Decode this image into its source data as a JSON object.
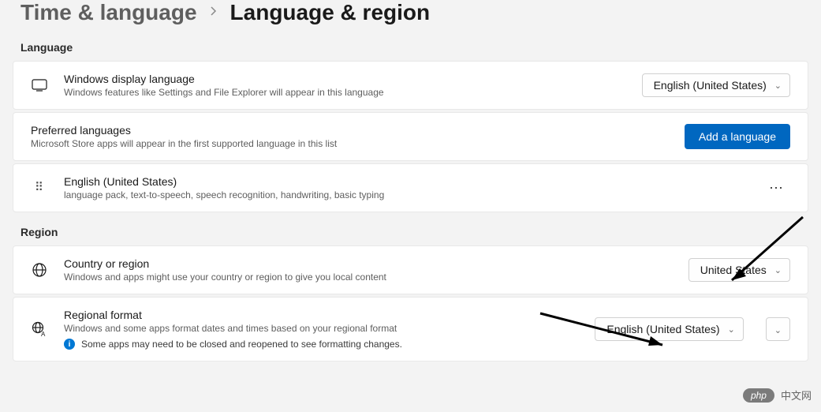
{
  "breadcrumb": {
    "parent": "Time & language",
    "current": "Language & region"
  },
  "sections": {
    "language": {
      "title": "Language"
    },
    "region": {
      "title": "Region"
    }
  },
  "displayLanguage": {
    "title": "Windows display language",
    "desc": "Windows features like Settings and File Explorer will appear in this language",
    "value": "English (United States)"
  },
  "preferredLanguages": {
    "title": "Preferred languages",
    "desc": "Microsoft Store apps will appear in the first supported language in this list",
    "addButton": "Add a language"
  },
  "languageItem": {
    "name": "English (United States)",
    "features": "language pack, text-to-speech, speech recognition, handwriting, basic typing"
  },
  "countryRegion": {
    "title": "Country or region",
    "desc": "Windows and apps might use your country or region to give you local content",
    "value": "United States"
  },
  "regionalFormat": {
    "title": "Regional format",
    "desc": "Windows and some apps format dates and times based on your regional format",
    "info": "Some apps may need to be closed and reopened to see formatting changes.",
    "value": "English (United States)"
  },
  "watermark": {
    "pill": "php",
    "text": "中文网"
  }
}
